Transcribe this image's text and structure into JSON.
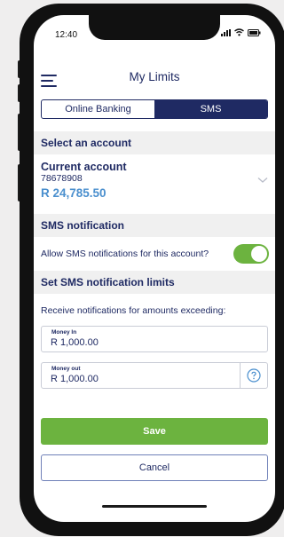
{
  "status_bar": {
    "time": "12:40"
  },
  "header": {
    "title": "My Limits"
  },
  "tabs": [
    {
      "label": "Online Banking",
      "active": false
    },
    {
      "label": "SMS",
      "active": true
    }
  ],
  "select_account": {
    "heading": "Select an account",
    "account_name": "Current account",
    "account_number": "78678908",
    "balance": "R 24,785.50"
  },
  "sms_notification": {
    "heading": "SMS notification",
    "allow_label": "Allow SMS notifications for this account?",
    "enabled": true
  },
  "limits": {
    "heading": "Set SMS notification limits",
    "description": "Receive notifications for amounts exceeding:",
    "money_in_label": "Money In",
    "money_in_value": "R 1,000.00",
    "money_out_label": "Money out",
    "money_out_value": "R 1,000.00"
  },
  "actions": {
    "save_label": "Save",
    "cancel_label": "Cancel"
  },
  "colors": {
    "navy": "#1f2a63",
    "green": "#6cb33f",
    "balance_blue": "#4a8fce"
  }
}
